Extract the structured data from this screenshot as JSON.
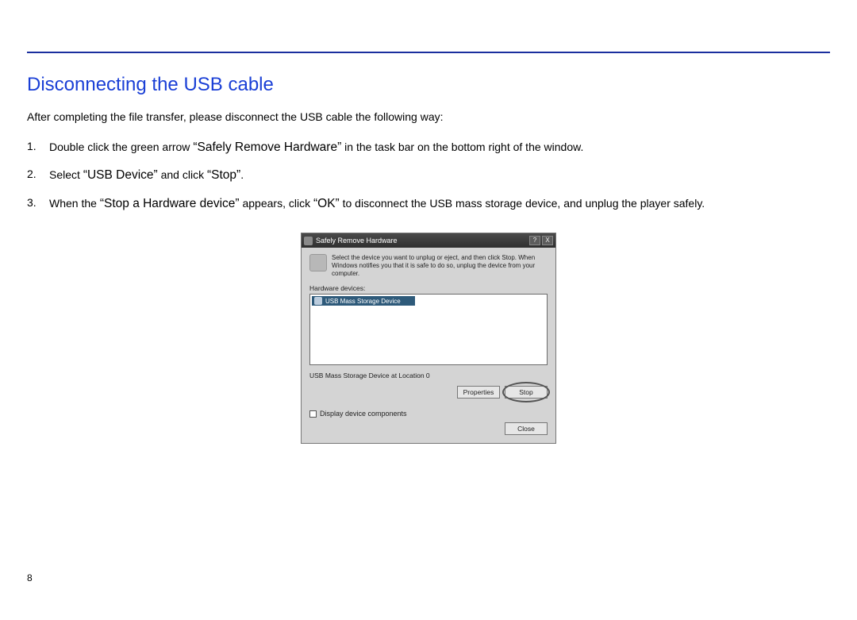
{
  "page": {
    "title": "Disconnecting the USB cable",
    "intro": "After completing the file transfer, please disconnect the USB cable the following way:",
    "steps": [
      {
        "num": "1.",
        "pre": "Double click the green arrow ",
        "q1": "Safely Remove Hardware",
        "post": " in the task bar on the bottom right of the window."
      },
      {
        "num": "2.",
        "pre": "Select ",
        "q1": "USB Device",
        "mid": " and click ",
        "q2": "Stop",
        "post": "."
      },
      {
        "num": "3.",
        "pre": "When the ",
        "q1": "Stop a Hardware device",
        "mid": " appears, click ",
        "q2": "OK",
        "post": " to disconnect the USB mass storage device, and unplug the player safely."
      }
    ],
    "page_number": "8"
  },
  "dialog": {
    "title": "Safely Remove Hardware",
    "help": "?",
    "close": "X",
    "description": "Select the device you want to unplug or eject, and then click Stop. When Windows notifies you that it is safe to do so, unplug the device from your computer.",
    "hw_label": "Hardware devices:",
    "list_item": "USB Mass Storage Device",
    "status": "USB Mass Storage Device at Location 0",
    "btn_properties": "Properties",
    "btn_stop": "Stop",
    "chk_label": "Display device components",
    "btn_close": "Close"
  }
}
